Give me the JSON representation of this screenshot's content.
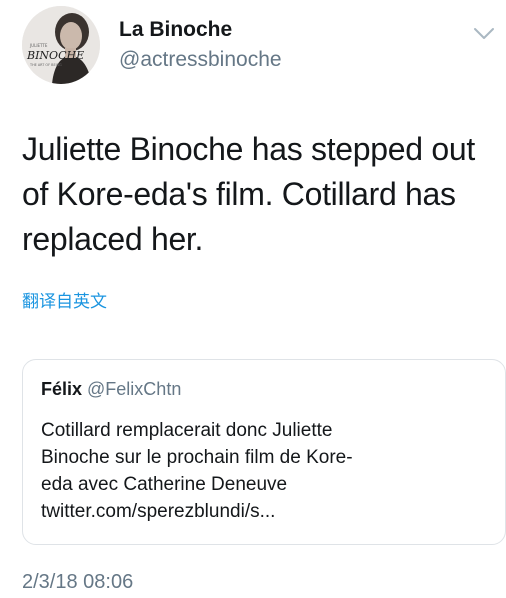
{
  "tweet": {
    "author": {
      "display_name": "La Binoche",
      "handle": "@actressbinoche",
      "avatar": {
        "icon": "profile-photo",
        "logo_small": "JULIETTE",
        "logo_main": "BINOCHE",
        "logo_sub": "THE ART OF BEING"
      }
    },
    "menu_icon": "chevron-down-icon",
    "text_lines": [
      "Juliette Binoche has stepped out",
      "of Kore-eda's film. Cotillard has",
      "replaced her."
    ],
    "translate_label": "翻译自英文",
    "quoted": {
      "name": "Félix",
      "handle": "@FelixChtn",
      "text_lines": [
        "Cotillard remplacerait donc Juliette",
        "Binoche sur le prochain film de Kore-",
        "eda avec Catherine Deneuve",
        "twitter.com/sperezblundi/s..."
      ]
    },
    "timestamp": "2/3/18 08:06"
  },
  "colors": {
    "text": "#14171a",
    "secondary": "#657786",
    "link": "#1b95e0",
    "border": "#dfe3e7"
  }
}
